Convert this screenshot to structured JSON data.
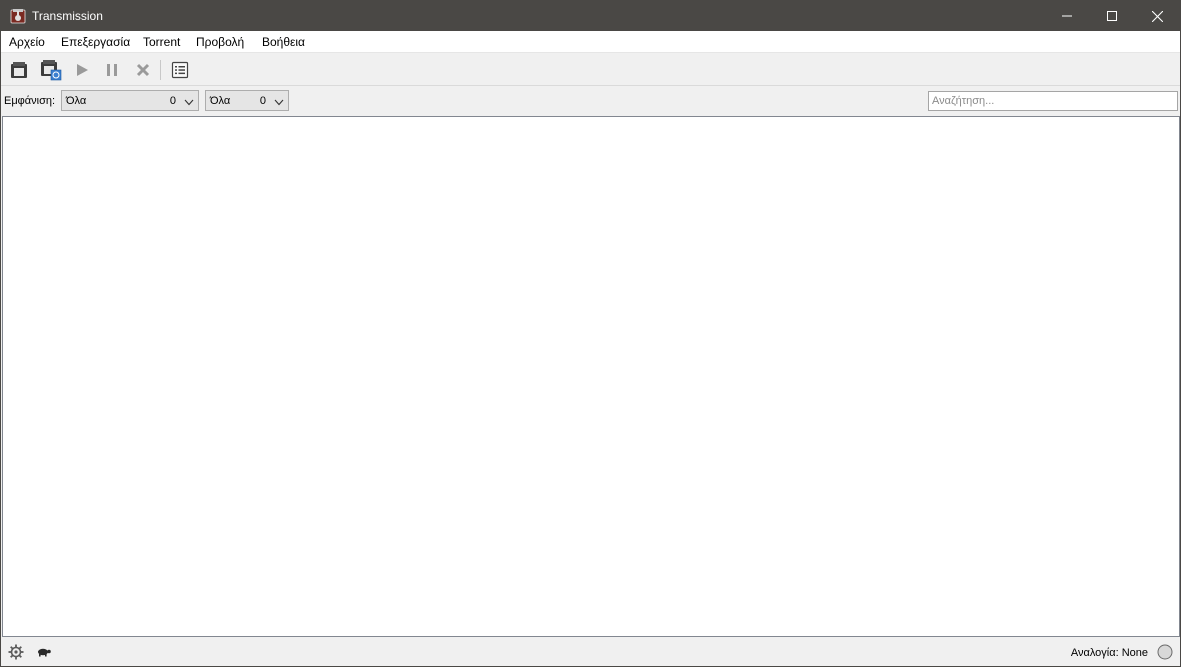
{
  "window": {
    "title": "Transmission"
  },
  "menu": {
    "items": [
      "Αρχείο",
      "Επεξεργασία",
      "Torrent",
      "Προβολή",
      "Βοήθεια"
    ]
  },
  "toolbar": {
    "buttons": [
      "open-torrent",
      "add-url",
      "start",
      "pause",
      "remove",
      "properties"
    ]
  },
  "filter": {
    "label": "Εμφάνιση:",
    "activity_value": "Όλα",
    "activity_count": "0",
    "tracker_value": "Όλα",
    "tracker_count": "0",
    "search_placeholder": "Αναζήτηση..."
  },
  "statusbar": {
    "ratio_label": "Αναλογία: None"
  },
  "colors": {
    "titlebar": "#4a4845",
    "window_bg": "#f0f0f0",
    "list_bg": "#ffffff"
  }
}
